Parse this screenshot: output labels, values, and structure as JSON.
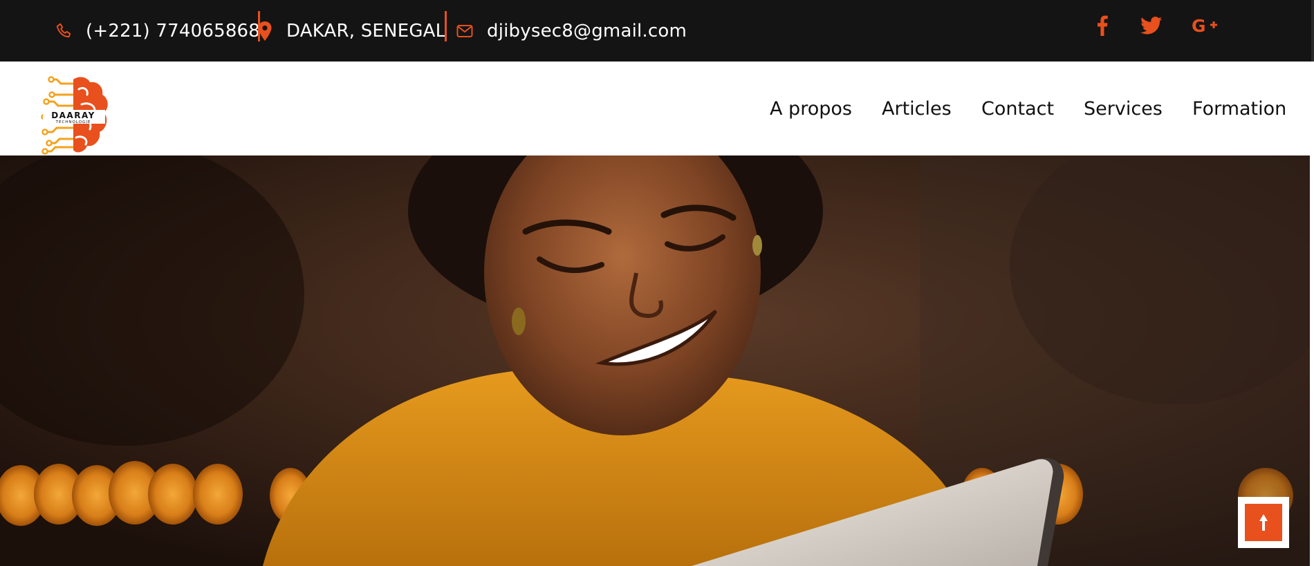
{
  "topbar": {
    "phone": "(+221) 774065868",
    "location": "DAKAR, SENEGAL",
    "email": "djibysec8@gmail.com",
    "icons": [
      "phone-icon",
      "location-pin-icon",
      "envelope-icon"
    ],
    "social": [
      "facebook-icon",
      "twitter-icon",
      "google-plus-icon"
    ]
  },
  "logo": {
    "line1": "DAARAY",
    "line2": "TECHNOLOGIE"
  },
  "nav": {
    "items": [
      {
        "label": "A propos"
      },
      {
        "label": "Articles"
      },
      {
        "label": "Contact"
      },
      {
        "label": "Services"
      },
      {
        "label": "Formation"
      }
    ]
  },
  "hero": {
    "image": "smiling-woman-with-tablet",
    "back_to_top_icon": "arrow-up-icon"
  },
  "colors": {
    "accent": "#e8501d",
    "topbar_bg": "#141414",
    "nav_bg": "#ffffff",
    "nav_text": "#111111"
  }
}
